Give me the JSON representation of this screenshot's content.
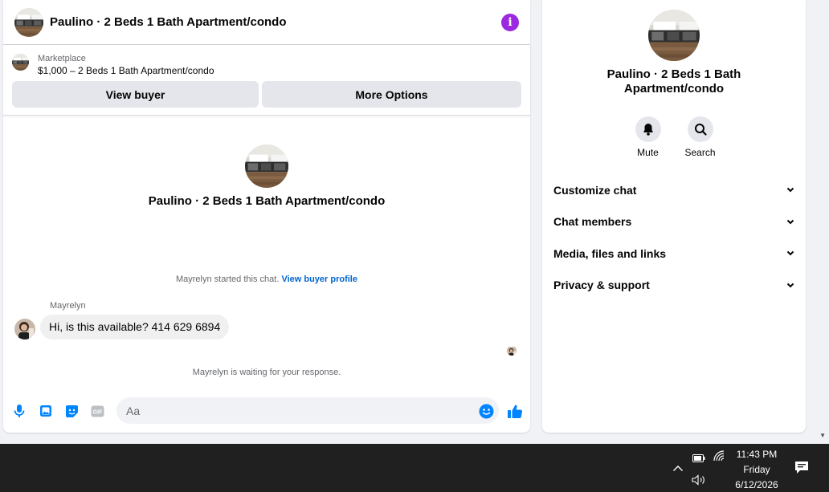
{
  "chat": {
    "title": "Paulino · 2 Beds 1 Bath Apartment/condo",
    "info_icon": "info-icon"
  },
  "listing": {
    "label": "Marketplace",
    "price_title": "$1,000 – 2 Beds 1 Bath Apartment/condo",
    "view_buyer": "View buyer",
    "more_options": "More Options"
  },
  "thread": {
    "title": "Paulino · 2 Beds 1 Bath Apartment/condo",
    "started_text": "Mayrelyn started this chat.",
    "profile_link": "View buyer profile",
    "sender": "Mayrelyn",
    "message": "Hi, is this available? 414 629 6894",
    "waiting": "Mayrelyn is waiting for your response."
  },
  "composer": {
    "placeholder": "Aa",
    "icons": [
      "microphone-icon",
      "photo-icon",
      "sticker-icon",
      "gif-icon",
      "emoji-icon",
      "like-icon"
    ]
  },
  "info_panel": {
    "title": "Paulino · 2 Beds 1 Bath Apartment/condo",
    "mute": "Mute",
    "search": "Search",
    "sections": [
      "Customize chat",
      "Chat members",
      "Media, files and links",
      "Privacy & support"
    ]
  },
  "taskbar": {
    "time": "11:43 PM",
    "day": "Friday",
    "date": "6/12/2026"
  },
  "colors": {
    "accent": "#0084ff",
    "info_purple": "#9b29e0",
    "link": "#0064d1"
  }
}
